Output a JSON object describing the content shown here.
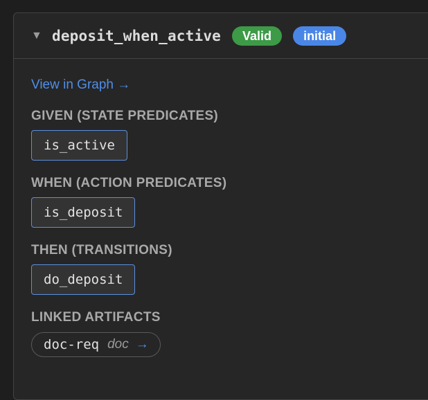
{
  "rule": {
    "caret": "▼",
    "name": "deposit_when_active",
    "status_badge": "Valid",
    "tag_badge": "initial"
  },
  "view_link": "View in Graph →",
  "given": {
    "label": "GIVEN (STATE PREDICATES)",
    "items": [
      "is_active"
    ]
  },
  "when": {
    "label": "WHEN (ACTION PREDICATES)",
    "items": [
      "is_deposit"
    ]
  },
  "then": {
    "label": "THEN (TRANSITIONS)",
    "items": [
      "do_deposit"
    ]
  },
  "linked": {
    "label": "LINKED ARTIFACTS",
    "items": [
      {
        "name": "doc-req",
        "type": "doc",
        "arrow": "→"
      }
    ]
  },
  "colors": {
    "background": "#1e1e1e",
    "panel": "#262626",
    "valid_badge": "#3d9a47",
    "initial_badge": "#4a86e6",
    "link": "#4f8ee8",
    "chip_border": "#5c8fe0"
  }
}
